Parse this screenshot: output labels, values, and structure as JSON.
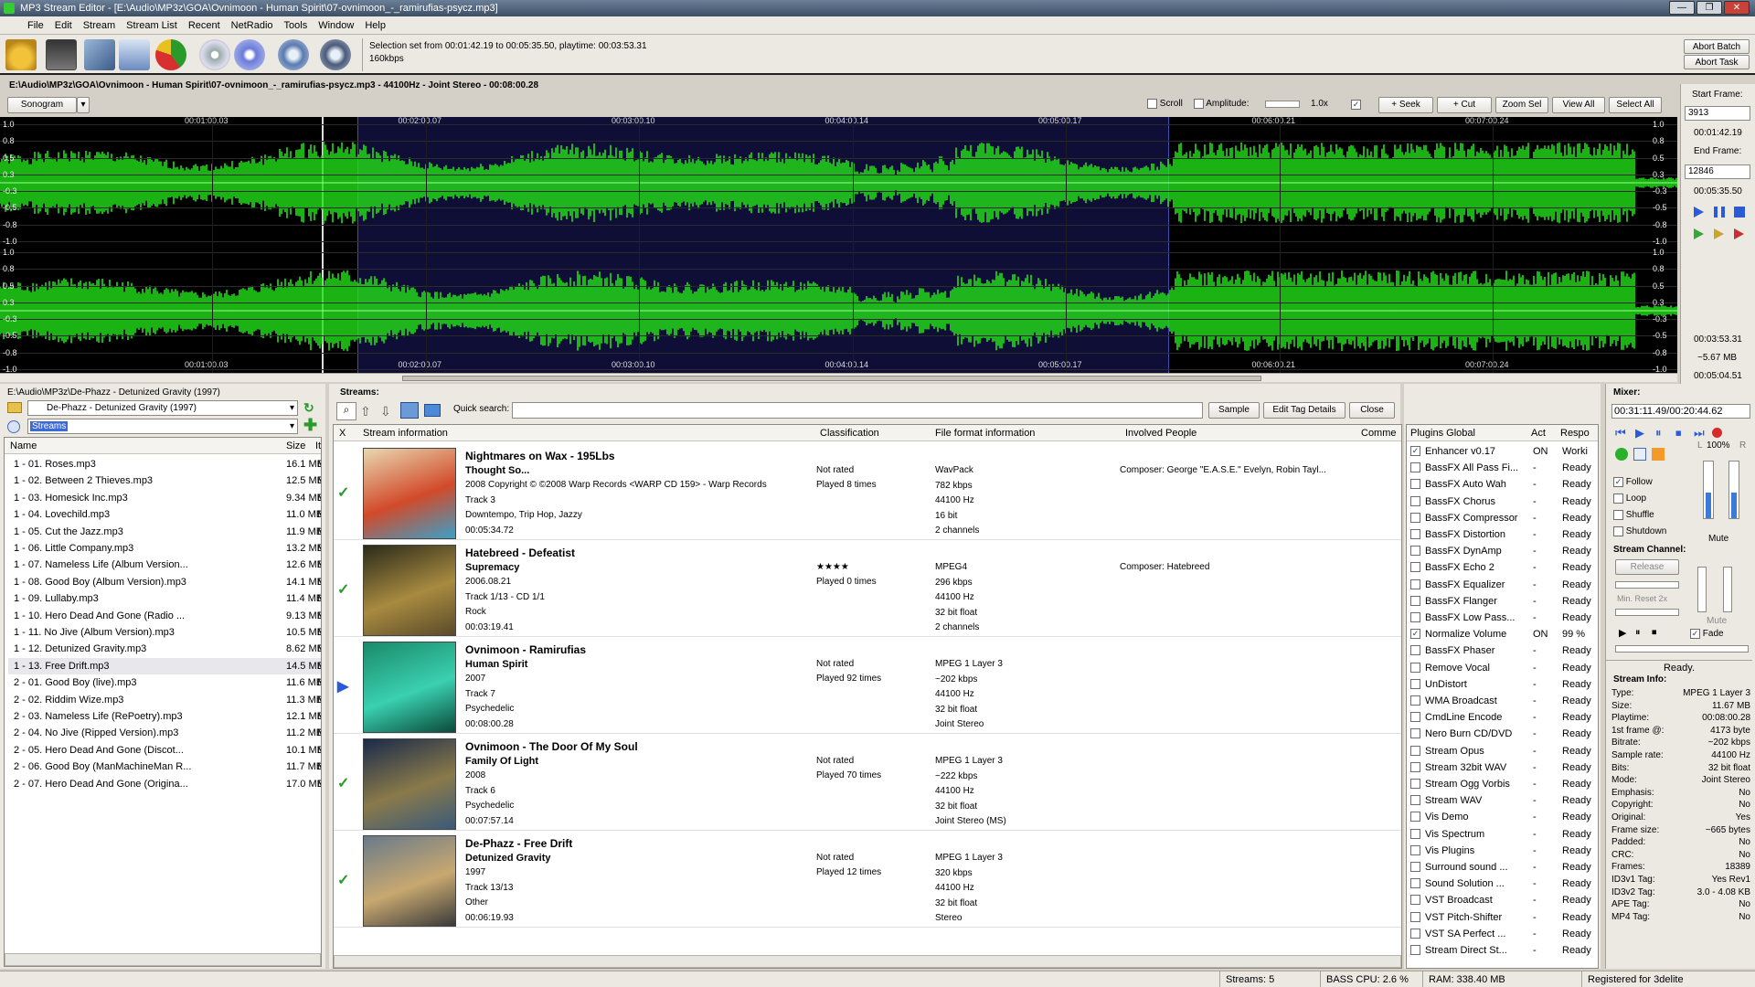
{
  "window": {
    "title": "MP3 Stream Editor - [E:\\Audio\\MP3z\\GOA\\Ovnimoon - Human Spirit\\07-ovnimoon_-_ramirufias-psycz.mp3]"
  },
  "menu": [
    "File",
    "Edit",
    "Stream",
    "Stream List",
    "Recent",
    "NetRadio",
    "Tools",
    "Window",
    "Help"
  ],
  "toolbar": {
    "status_line1": "Selection set from 00:01:42.19 to 00:05:35.50, playtime: 00:03:53.31",
    "status_line2": "160kbps",
    "abort_batch": "Abort Batch",
    "abort_task": "Abort Task"
  },
  "editor": {
    "file_info": "E:\\Audio\\MP3z\\GOA\\Ovnimoon - Human Spirit\\07-ovnimoon_-_ramirufias-psycz.mp3 - 44100Hz - Joint Stereo - 00:08:00.28",
    "view_mode": "Sonogram",
    "scroll_label": "Scroll",
    "amplitude_label": "Amplitude:",
    "amplitude_value": "1.0x",
    "buttons": [
      "+ Seek",
      "+ Cut",
      "Zoom Sel",
      "View All",
      "Select All"
    ],
    "time_ticks": [
      "00:01:00.03",
      "00:02:00.07",
      "00:03:00.10",
      "00:04:00.14",
      "00:05:00.17",
      "00:06:00.21",
      "00:07:00.24"
    ],
    "amp_labels": [
      "1.0",
      "0.8",
      "0.5",
      "0.3",
      "-0.3",
      "-0.5",
      "-0.8",
      "-1.0"
    ],
    "selection_fraction": [
      0.213,
      0.697
    ],
    "start_frame_label": "Start Frame:",
    "start_frame": "3913",
    "start_time": "00:01:42.19",
    "end_frame_label": "End Frame:",
    "end_frame": "12846",
    "end_time": "00:05:35.50",
    "sel_duration": "00:03:53.31",
    "sel_size": "~5.67 MB",
    "total_time": "00:05:04.51"
  },
  "browser": {
    "path": "E:\\Audio\\MP3z\\De-Phazz - Detunized Gravity (1997)",
    "folder": "De-Phazz - Detunized Gravity (1997)",
    "filter": "Streams",
    "columns": [
      "Name",
      "Size",
      "It"
    ],
    "files": [
      {
        "name": "1 - 01. Roses.mp3",
        "size": "16.1 MB",
        "t": "M"
      },
      {
        "name": "1 - 02. Between 2 Thieves.mp3",
        "size": "12.5 MB",
        "t": "M"
      },
      {
        "name": "1 - 03. Homesick Inc.mp3",
        "size": "9.34 MB",
        "t": "M"
      },
      {
        "name": "1 - 04. Lovechild.mp3",
        "size": "11.0 MB",
        "t": "M"
      },
      {
        "name": "1 - 05. Cut the Jazz.mp3",
        "size": "11.9 MB",
        "t": "M"
      },
      {
        "name": "1 - 06. Little Company.mp3",
        "size": "13.2 MB",
        "t": "M"
      },
      {
        "name": "1 - 07. Nameless Life (Album Version...",
        "size": "12.6 MB",
        "t": "M"
      },
      {
        "name": "1 - 08. Good Boy (Album Version).mp3",
        "size": "14.1 MB",
        "t": "M"
      },
      {
        "name": "1 - 09. Lullaby.mp3",
        "size": "11.4 MB",
        "t": "M"
      },
      {
        "name": "1 - 10. Hero Dead And Gone (Radio ...",
        "size": "9.13 MB",
        "t": "M"
      },
      {
        "name": "1 - 11. No Jive (Album Version).mp3",
        "size": "10.5 MB",
        "t": "M"
      },
      {
        "name": "1 - 12. Detunized Gravity.mp3",
        "size": "8.62 MB",
        "t": "M"
      },
      {
        "name": "1 - 13. Free Drift.mp3",
        "size": "14.5 MB",
        "t": "M"
      },
      {
        "name": "2 - 01. Good Boy (live).mp3",
        "size": "11.6 MB",
        "t": "M"
      },
      {
        "name": "2 - 02. Riddim Wize.mp3",
        "size": "11.3 MB",
        "t": "M"
      },
      {
        "name": "2 - 03. Nameless Life (RePoetry).mp3",
        "size": "12.1 MB",
        "t": "M"
      },
      {
        "name": "2 - 04. No Jive (Ripped Version).mp3",
        "size": "11.2 MB",
        "t": "M"
      },
      {
        "name": "2 - 05. Hero Dead And Gone (Discot...",
        "size": "10.1 MB",
        "t": "M"
      },
      {
        "name": "2 - 06. Good Boy (ManMachineMan R...",
        "size": "11.7 MB",
        "t": "M"
      },
      {
        "name": "2 - 07. Hero Dead And Gone (Origina...",
        "size": "17.0 MB",
        "t": "M"
      }
    ]
  },
  "streams": {
    "label": "Streams:",
    "quick_search_label": "Quick search:",
    "buttons": [
      "Sample",
      "Edit Tag Details",
      "Close"
    ],
    "columns": [
      "X",
      "Stream information",
      "Classification",
      "File format information",
      "Involved People",
      "Comme"
    ],
    "items": [
      {
        "title": "Nightmares on Wax - 195Lbs",
        "album": "Thought So...",
        "lines": [
          "2008 Copyright © ©2008 Warp Records <WARP CD 159> - Warp Records",
          "Track 3",
          "Downtempo, Trip Hop, Jazzy",
          "00:05:34.72"
        ],
        "class": [
          "Not rated",
          "Played 8 times"
        ],
        "format": [
          "WavPack",
          "782 kbps",
          "44100 Hz",
          "16 bit",
          "2 channels"
        ],
        "people": "Composer: George \"E.A.S.E.\" Evelyn, Robin Tayl...",
        "status": "check",
        "art_colors": [
          "#e8d8b0",
          "#d24a2a",
          "#3aa0c8"
        ]
      },
      {
        "title": "Hatebreed - Defeatist",
        "album": "Supremacy",
        "lines": [
          "2006.08.21",
          "Track 1/13 - CD 1/1",
          "Rock",
          "00:03:19.41"
        ],
        "class": [
          "★★★★",
          "Played 0 times"
        ],
        "format": [
          "MPEG4",
          "296 kbps",
          "44100 Hz",
          "32 bit float",
          "2 channels"
        ],
        "people": "Composer: Hatebreed",
        "status": "check",
        "art_colors": [
          "#2a2a1a",
          "#a88a40",
          "#5a4a2a"
        ]
      },
      {
        "title": "Ovnimoon - Ramirufias",
        "album": "Human Spirit",
        "lines": [
          "2007",
          "Track 7",
          "Psychedelic",
          "00:08:00.28"
        ],
        "class": [
          "Not rated",
          "Played 92 times"
        ],
        "format": [
          "MPEG 1 Layer 3",
          "~202 kbps",
          "44100 Hz",
          "32 bit float",
          "Joint Stereo"
        ],
        "people": "",
        "status": "play",
        "art_colors": [
          "#1a8a6a",
          "#3ad0b0",
          "#0a4a3a"
        ]
      },
      {
        "title": "Ovnimoon - The Door Of My Soul",
        "album": "Family Of Light",
        "lines": [
          "2008",
          "Track 6",
          "Psychedelic",
          "00:07:57.14"
        ],
        "class": [
          "Not rated",
          "Played 70 times"
        ],
        "format": [
          "MPEG 1 Layer 3",
          "~222 kbps",
          "44100 Hz",
          "32 bit float",
          "Joint Stereo (MS)"
        ],
        "people": "",
        "status": "check",
        "art_colors": [
          "#1a2a4a",
          "#8a7a4a",
          "#3a5a7a"
        ]
      },
      {
        "title": "De-Phazz - Free Drift",
        "album": "Detunized Gravity",
        "lines": [
          "1997",
          "Track 13/13",
          "Other",
          "00:06:19.93"
        ],
        "class": [
          "Not rated",
          "Played 12 times"
        ],
        "format": [
          "MPEG 1 Layer 3",
          "320 kbps",
          "44100 Hz",
          "32 bit float",
          "Stereo"
        ],
        "people": "",
        "status": "check",
        "art_colors": [
          "#6a7a8a",
          "#c8a870",
          "#3a3a3a"
        ]
      }
    ]
  },
  "plugins": {
    "columns": [
      "Plugins Global",
      "Act",
      "Respo"
    ],
    "items": [
      {
        "name": "Enhancer v0.17",
        "checked": true,
        "act": "ON",
        "resp": "Worki"
      },
      {
        "name": "BassFX All Pass Fi...",
        "checked": false,
        "act": "-",
        "resp": "Ready"
      },
      {
        "name": "BassFX Auto Wah",
        "checked": false,
        "act": "-",
        "resp": "Ready"
      },
      {
        "name": "BassFX Chorus",
        "checked": false,
        "act": "-",
        "resp": "Ready"
      },
      {
        "name": "BassFX Compressor",
        "checked": false,
        "act": "-",
        "resp": "Ready"
      },
      {
        "name": "BassFX Distortion",
        "checked": false,
        "act": "-",
        "resp": "Ready"
      },
      {
        "name": "BassFX DynAmp",
        "checked": false,
        "act": "-",
        "resp": "Ready"
      },
      {
        "name": "BassFX Echo 2",
        "checked": false,
        "act": "-",
        "resp": "Ready"
      },
      {
        "name": "BassFX Equalizer",
        "checked": false,
        "act": "-",
        "resp": "Ready"
      },
      {
        "name": "BassFX Flanger",
        "checked": false,
        "act": "-",
        "resp": "Ready"
      },
      {
        "name": "BassFX Low Pass...",
        "checked": false,
        "act": "-",
        "resp": "Ready"
      },
      {
        "name": "Normalize Volume",
        "checked": true,
        "act": "ON",
        "resp": "99 %"
      },
      {
        "name": "BassFX Phaser",
        "checked": false,
        "act": "-",
        "resp": "Ready"
      },
      {
        "name": "Remove Vocal",
        "checked": false,
        "act": "-",
        "resp": "Ready"
      },
      {
        "name": "UnDistort",
        "checked": false,
        "act": "-",
        "resp": "Ready"
      },
      {
        "name": "WMA Broadcast",
        "checked": false,
        "act": "-",
        "resp": "Ready"
      },
      {
        "name": "CmdLine Encode",
        "checked": false,
        "act": "-",
        "resp": "Ready"
      },
      {
        "name": "Nero Burn CD/DVD",
        "checked": false,
        "act": "-",
        "resp": "Ready"
      },
      {
        "name": "Stream Opus",
        "checked": false,
        "act": "-",
        "resp": "Ready"
      },
      {
        "name": "Stream 32bit WAV",
        "checked": false,
        "act": "-",
        "resp": "Ready"
      },
      {
        "name": "Stream Ogg Vorbis",
        "checked": false,
        "act": "-",
        "resp": "Ready"
      },
      {
        "name": "Stream WAV",
        "checked": false,
        "act": "-",
        "resp": "Ready"
      },
      {
        "name": "Vis Demo",
        "checked": false,
        "act": "-",
        "resp": "Ready"
      },
      {
        "name": "Vis Spectrum",
        "checked": false,
        "act": "-",
        "resp": "Ready"
      },
      {
        "name": "Vis Plugins",
        "checked": false,
        "act": "-",
        "resp": "Ready"
      },
      {
        "name": "Surround sound ...",
        "checked": false,
        "act": "-",
        "resp": "Ready"
      },
      {
        "name": "Sound Solution ...",
        "checked": false,
        "act": "-",
        "resp": "Ready"
      },
      {
        "name": "VST Broadcast",
        "checked": false,
        "act": "-",
        "resp": "Ready"
      },
      {
        "name": "VST Pitch-Shifter",
        "checked": false,
        "act": "-",
        "resp": "Ready"
      },
      {
        "name": "VST SA Perfect ...",
        "checked": false,
        "act": "-",
        "resp": "Ready"
      },
      {
        "name": "Stream Direct St...",
        "checked": false,
        "act": "-",
        "resp": "Ready"
      }
    ]
  },
  "mixer": {
    "label": "Mixer:",
    "time": "00:31:11.49/00:20:44.62",
    "volume": "100%",
    "l": "L",
    "r": "R",
    "mute": "Mute",
    "follow": "Follow",
    "loop": "Loop",
    "shuffle": "Shuffle",
    "shutdown": "Shutdown",
    "stream_channel": "Stream Channel:",
    "release": "Release",
    "min_reset": "Min. Reset 2x",
    "mute2": "Mute",
    "fade": "Fade",
    "status": "Ready.",
    "stream_info_label": "Stream Info:",
    "info": [
      {
        "k": "Type:",
        "v": "MPEG 1 Layer 3"
      },
      {
        "k": "Size:",
        "v": "11.67 MB"
      },
      {
        "k": "Playtime:",
        "v": "00:08:00.28"
      },
      {
        "k": "1st frame @:",
        "v": "4173 byte"
      },
      {
        "k": "Bitrate:",
        "v": "~202 kbps"
      },
      {
        "k": "Sample rate:",
        "v": "44100 Hz"
      },
      {
        "k": "Bits:",
        "v": "32 bit float"
      },
      {
        "k": "Mode:",
        "v": "Joint Stereo"
      },
      {
        "k": "Emphasis:",
        "v": "No"
      },
      {
        "k": "Copyright:",
        "v": "No"
      },
      {
        "k": "Original:",
        "v": "Yes"
      },
      {
        "k": "Frame size:",
        "v": "~665 bytes"
      },
      {
        "k": "Padded:",
        "v": "No"
      },
      {
        "k": "CRC:",
        "v": "No"
      },
      {
        "k": "Frames:",
        "v": "18389"
      },
      {
        "k": "ID3v1 Tag:",
        "v": "Yes Rev1"
      },
      {
        "k": "ID3v2 Tag:",
        "v": "3.0 - 4.08 KB"
      },
      {
        "k": "APE Tag:",
        "v": "No"
      },
      {
        "k": "MP4 Tag:",
        "v": "No"
      }
    ]
  },
  "status": {
    "streams": "Streams: 5",
    "cpu": "BASS CPU: 2.6 %",
    "ram": "RAM: 338.40 MB",
    "registered": "Registered for 3delite"
  }
}
